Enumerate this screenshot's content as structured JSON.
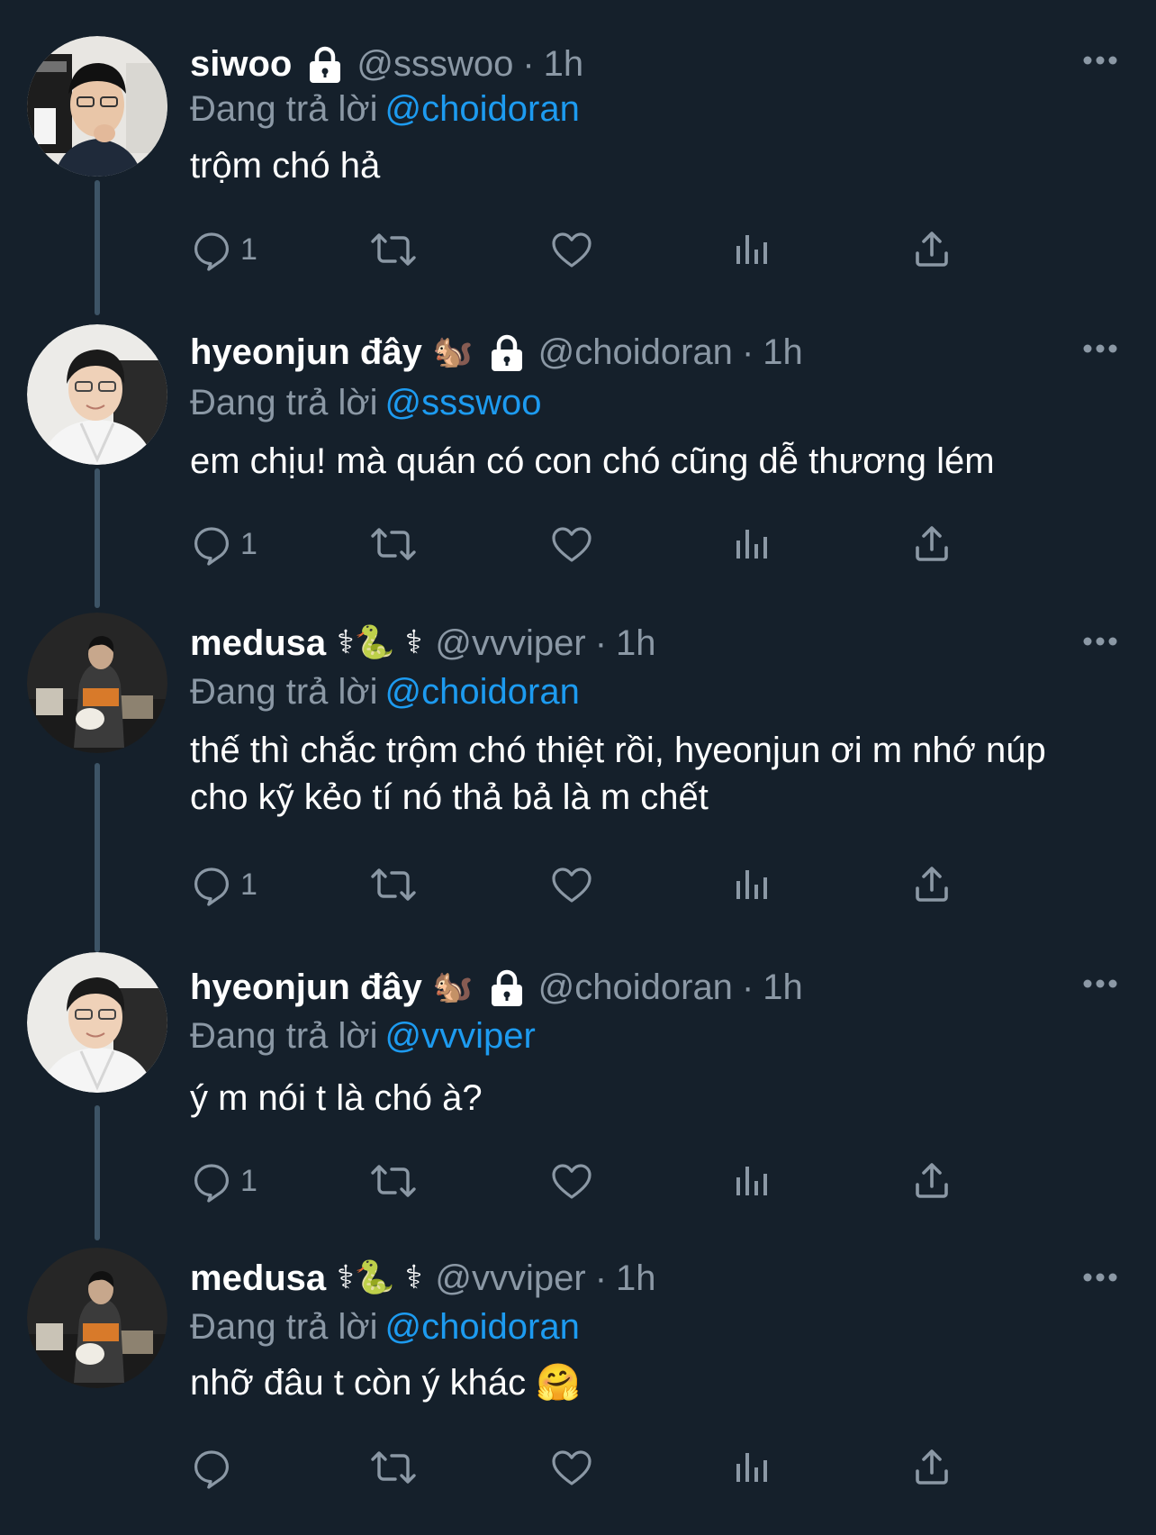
{
  "colors": {
    "background": "#15202b",
    "text_primary": "#ffffff",
    "text_secondary": "#8b98a5",
    "link": "#1d9bf0",
    "thread_line": "#3d5466"
  },
  "replying_prefix": "Đang trả lời",
  "tweets": [
    {
      "name": "siwoo",
      "emoji": "",
      "protected": true,
      "handle": "@ssswoo",
      "separator": "·",
      "time": "1h",
      "replying_to": "@choidoran",
      "text": "trộm chó hả",
      "reply_count": "1",
      "avatar": "photo-desk"
    },
    {
      "name": "hyeonjun đây",
      "emoji": "🐿️",
      "protected": true,
      "handle": "@choidoran",
      "separator": "·",
      "time": "1h",
      "replying_to": "@ssswoo",
      "text": "em chịu! mà quán có con chó cũng dễ thương lém",
      "reply_count": "1",
      "avatar": "photo-white-hoodie"
    },
    {
      "name": "medusa",
      "emoji": "⚕🐍 ⚕",
      "protected": false,
      "handle": "@vvviper",
      "separator": "·",
      "time": "1h",
      "replying_to": "@choidoran",
      "text": "thế thì chắc trộm chó thiệt rồi, hyeonjun ơi m nhớ núp cho kỹ kẻo tí nó thả bả là m chết",
      "reply_count": "1",
      "avatar": "photo-dark-room"
    },
    {
      "name": "hyeonjun đây",
      "emoji": "🐿️",
      "protected": true,
      "handle": "@choidoran",
      "separator": "·",
      "time": "1h",
      "replying_to": "@vvviper",
      "text": "ý m nói t là chó à?",
      "reply_count": "1",
      "avatar": "photo-white-hoodie"
    },
    {
      "name": "medusa",
      "emoji": "⚕🐍 ⚕",
      "protected": false,
      "handle": "@vvviper",
      "separator": "·",
      "time": "1h",
      "replying_to": "@choidoran",
      "text": "nhỡ đâu t còn ý khác 🤗",
      "reply_count": "",
      "avatar": "photo-dark-room"
    }
  ]
}
